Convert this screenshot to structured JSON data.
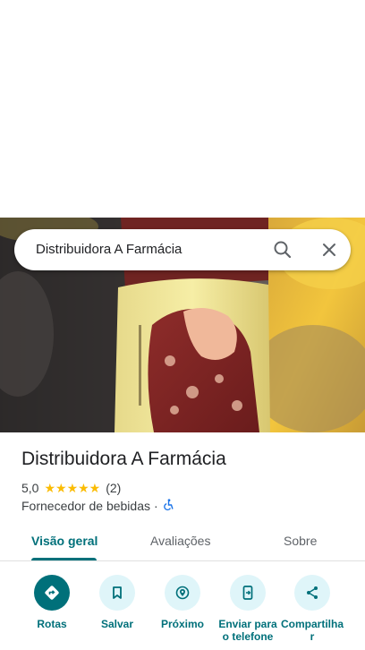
{
  "search": {
    "query": "Distribuidora A Farmácia"
  },
  "place": {
    "name": "Distribuidora A Farmácia",
    "rating": "5,0",
    "stars": "★★★★★",
    "review_count": "(2)",
    "category": "Fornecedor de bebidas",
    "separator": "·",
    "accessibility_icon": "wheelchair-icon"
  },
  "tabs": [
    {
      "label": "Visão geral",
      "active": true
    },
    {
      "label": "Avaliações",
      "active": false
    },
    {
      "label": "Sobre",
      "active": false
    }
  ],
  "actions": [
    {
      "label": "Rotas",
      "icon": "directions-icon"
    },
    {
      "label": "Salvar",
      "icon": "bookmark-icon"
    },
    {
      "label": "Próximo",
      "icon": "nearby-icon"
    },
    {
      "label": "Enviar para o telefone",
      "icon": "send-to-phone-icon"
    },
    {
      "label": "Compartilhar",
      "icon": "share-icon"
    }
  ],
  "colors": {
    "accent": "#00707a",
    "star": "#fbbc04",
    "action_bg": "#dff5f9"
  }
}
